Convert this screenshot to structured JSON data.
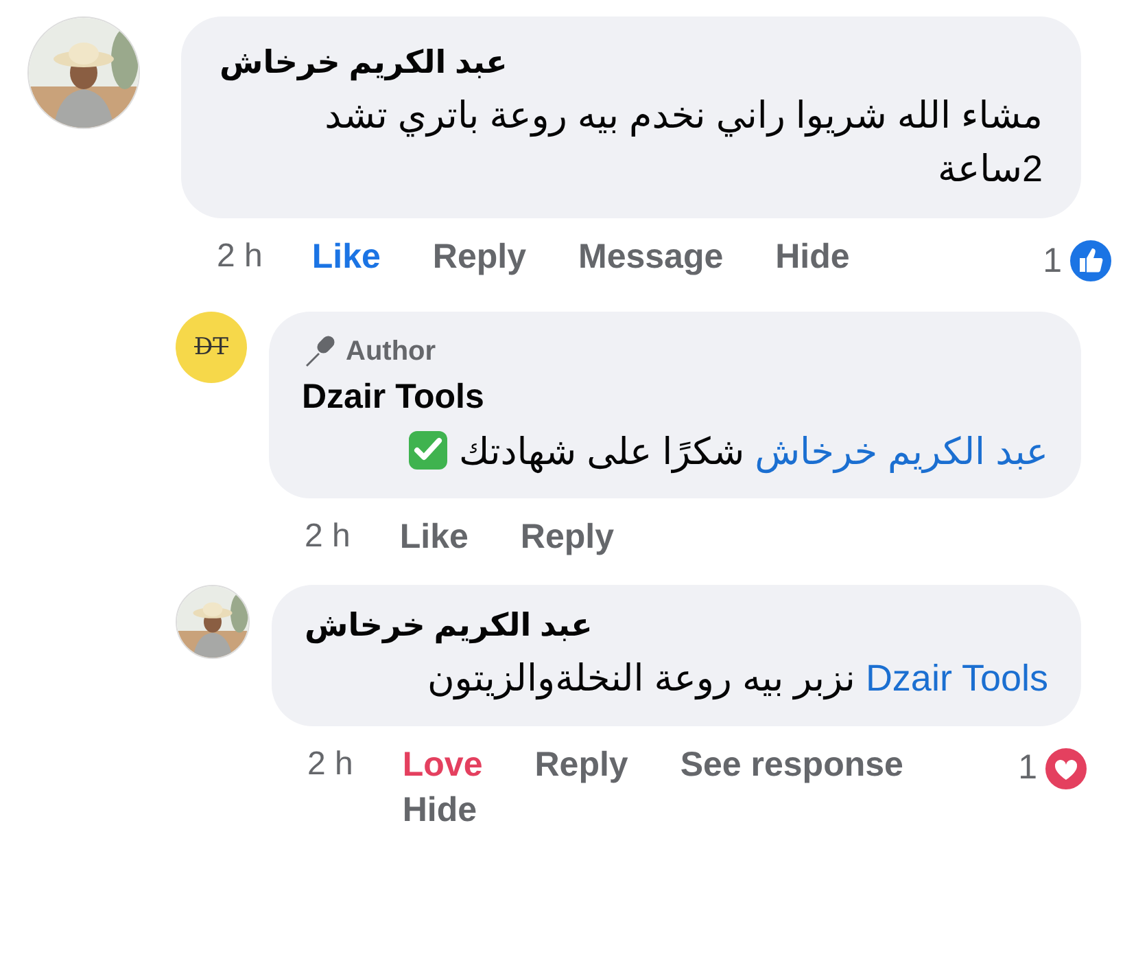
{
  "comment": {
    "avatar": {
      "kind": "picture"
    },
    "name": "عبد الكريم خرخاش",
    "body": [
      {
        "kind": "text",
        "text": "مشاء الله  شريوا راني نخدم بيه روعة  باتري تشد 2ساعة"
      }
    ],
    "time": "2 h",
    "actions": {
      "react": {
        "label": "Like",
        "kind": "like",
        "selected": true
      },
      "reply": "Reply",
      "message": "Message",
      "hide": "Hide"
    },
    "reaction": {
      "count": "1",
      "kind": "like"
    },
    "replies": [
      {
        "avatar": {
          "kind": "logo",
          "initials": "DT"
        },
        "badge": "Author",
        "name": "Dzair Tools",
        "body": [
          {
            "kind": "mention",
            "text": "عبد الكريم خرخاش"
          },
          {
            "kind": "text",
            "text": "شكرًا على شهادتك"
          },
          {
            "kind": "check"
          }
        ],
        "time": "2 h",
        "actions": {
          "react": {
            "label": "Like",
            "kind": "like",
            "selected": false
          },
          "reply": "Reply"
        }
      },
      {
        "avatar": {
          "kind": "picture"
        },
        "name": "عبد الكريم خرخاش",
        "body": [
          {
            "kind": "mention",
            "text": "Dzair Tools"
          },
          {
            "kind": "text",
            "text": "نزبر بيه روعة النخلةوالزيتون"
          }
        ],
        "time": "2 h",
        "actions": {
          "react": {
            "label": "Love",
            "kind": "love",
            "selected": true
          },
          "reply": "Reply",
          "see_response": "See response",
          "hide": "Hide"
        },
        "reaction": {
          "count": "1",
          "kind": "love"
        }
      }
    ]
  }
}
